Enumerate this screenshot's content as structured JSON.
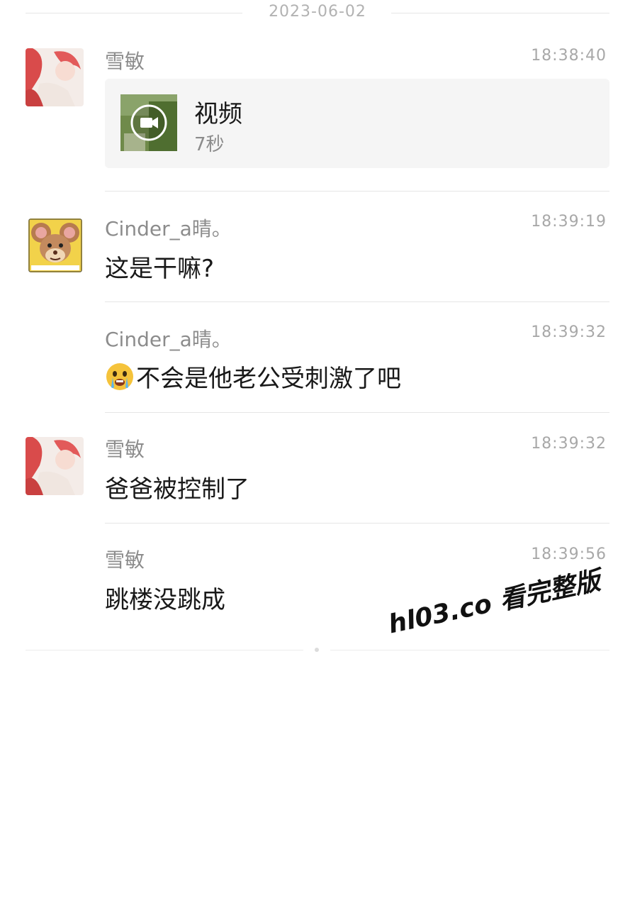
{
  "date_separator": "2023-06-02",
  "messages": [
    {
      "sender": "雪敏",
      "time": "18:38:40",
      "type": "video",
      "video_title": "视频",
      "video_duration": "7秒"
    },
    {
      "sender": "Cinder_a晴。",
      "time": "18:39:19",
      "text": "这是干嘛?"
    },
    {
      "sender": "Cinder_a晴。",
      "time": "18:39:32",
      "text": "不会是他老公受刺激了吧",
      "emoji": "crying-face"
    },
    {
      "sender": "雪敏",
      "time": "18:39:32",
      "text": "爸爸被控制了"
    },
    {
      "sender": "雪敏",
      "time": "18:39:56",
      "text": "跳楼没跳成"
    }
  ],
  "watermark": "hl03.co 看完整版",
  "colors": {
    "background": "#ffffff",
    "text_primary": "#191919",
    "text_secondary": "#8c8c8c",
    "divider": "#e6e6e6",
    "card_bg": "#f5f5f5"
  }
}
